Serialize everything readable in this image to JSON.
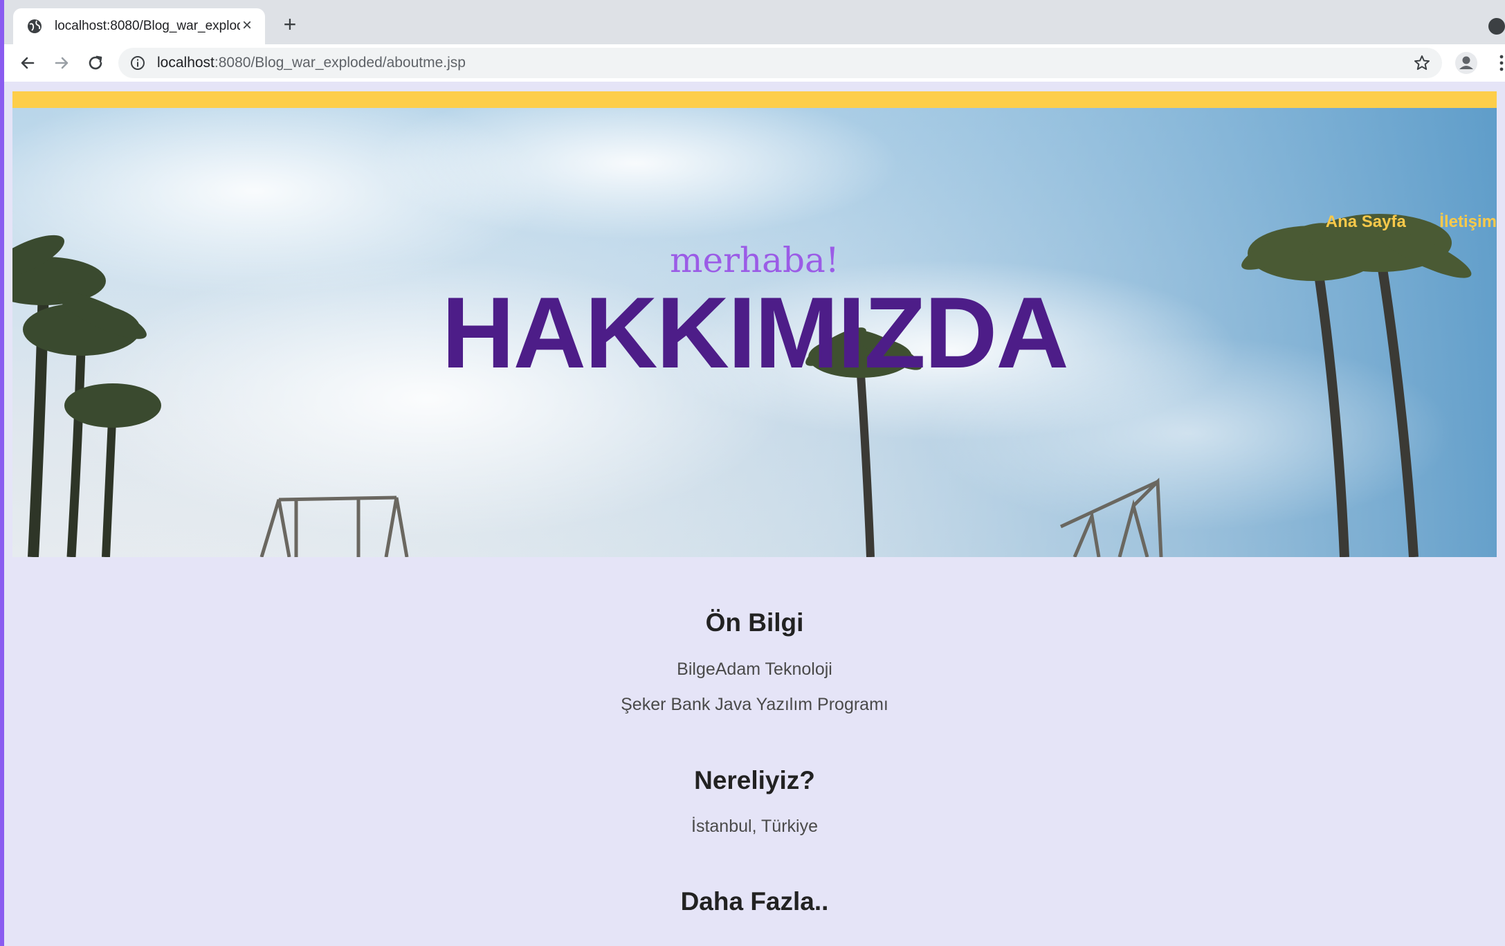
{
  "browser": {
    "tab": {
      "title": "localhost:8080/Blog_war_exploded/aboutme.jsp",
      "close_glyph": "×",
      "icon": "globe-icon"
    },
    "new_tab_glyph": "+",
    "address": {
      "host": "localhost",
      "rest": ":8080/Blog_war_exploded/aboutme.jsp"
    },
    "icons": [
      "back-arrow-icon",
      "forward-arrow-icon",
      "reload-icon",
      "info-icon",
      "star-icon",
      "profile-icon",
      "kebab-menu-icon",
      "tab-search-icon"
    ]
  },
  "page": {
    "nav": {
      "home": "Ana Sayfa",
      "contact": "İletişim"
    },
    "hero": {
      "greeting": "merhaba!",
      "title": "HAKKIMIZDA"
    },
    "sections": [
      {
        "heading": "Ön Bilgi",
        "lines": [
          "BilgeAdam Teknoloji",
          "Şeker Bank Java Yazılım Programı"
        ]
      },
      {
        "heading": "Nereliyiz?",
        "lines": [
          "İstanbul, Türkiye"
        ]
      },
      {
        "heading": "Daha Fazla..",
        "lines": []
      }
    ],
    "colors": {
      "accent_bar": "#fdce4a",
      "title": "#4d1d88",
      "greeting": "#9b5ce6",
      "nav": "#f9c94a",
      "background": "#e5e4f7"
    }
  }
}
